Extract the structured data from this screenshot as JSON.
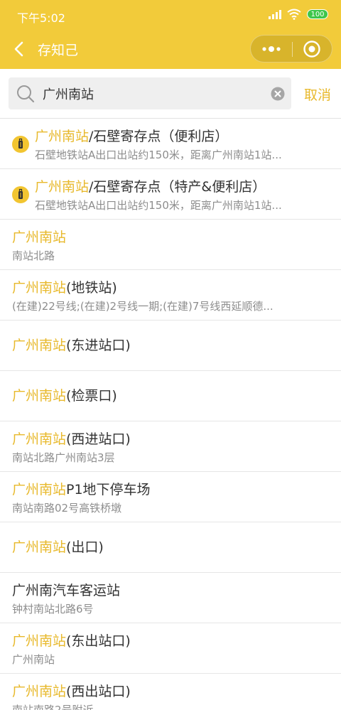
{
  "status_bar": {
    "time": "下午5:02",
    "battery": "100"
  },
  "nav": {
    "title": "存知己"
  },
  "search": {
    "value": "广州南站",
    "cancel_label": "取消"
  },
  "results": [
    {
      "highlight": "广州南站",
      "rest": "/石壁寄存点（便利店）",
      "subtitle": "石壁地铁站A出口出站约150米，距离广州南站1站...",
      "icon": "luggage-icon"
    },
    {
      "highlight": "广州南站",
      "rest": "/石壁寄存点（特产&便利店）",
      "subtitle": "石壁地铁站A出口出站约150米，距离广州南站1站...",
      "icon": "luggage-icon"
    },
    {
      "highlight": "广州南站",
      "rest": "",
      "subtitle": "南站北路"
    },
    {
      "highlight": "广州南站",
      "rest": "(地铁站)",
      "subtitle": "(在建)22号线;(在建)2号线一期;(在建)7号线西延顺德..."
    },
    {
      "highlight": "广州南站",
      "rest": "(东进站口)",
      "subtitle": ""
    },
    {
      "highlight": "广州南站",
      "rest": "(检票口)",
      "subtitle": ""
    },
    {
      "highlight": "广州南站",
      "rest": "(西进站口)",
      "subtitle": "南站北路广州南站3层"
    },
    {
      "highlight": "广州南站",
      "rest": "P1地下停车场",
      "subtitle": "南站南路02号高铁桥墩"
    },
    {
      "highlight": "广州南站",
      "rest": "(出口)",
      "subtitle": ""
    },
    {
      "highlight": "",
      "rest": "广州南汽车客运站",
      "subtitle": "钟村南站北路6号"
    },
    {
      "highlight": "广州南站",
      "rest": "(东出站口)",
      "subtitle": "广州南站"
    },
    {
      "highlight": "广州南站",
      "rest": "(西出站口)",
      "subtitle": "南站南路2号附近"
    }
  ],
  "colors": {
    "brand": "#f2cb3a",
    "highlight": "#e8b92c",
    "subtitle": "#8d8d8d"
  }
}
